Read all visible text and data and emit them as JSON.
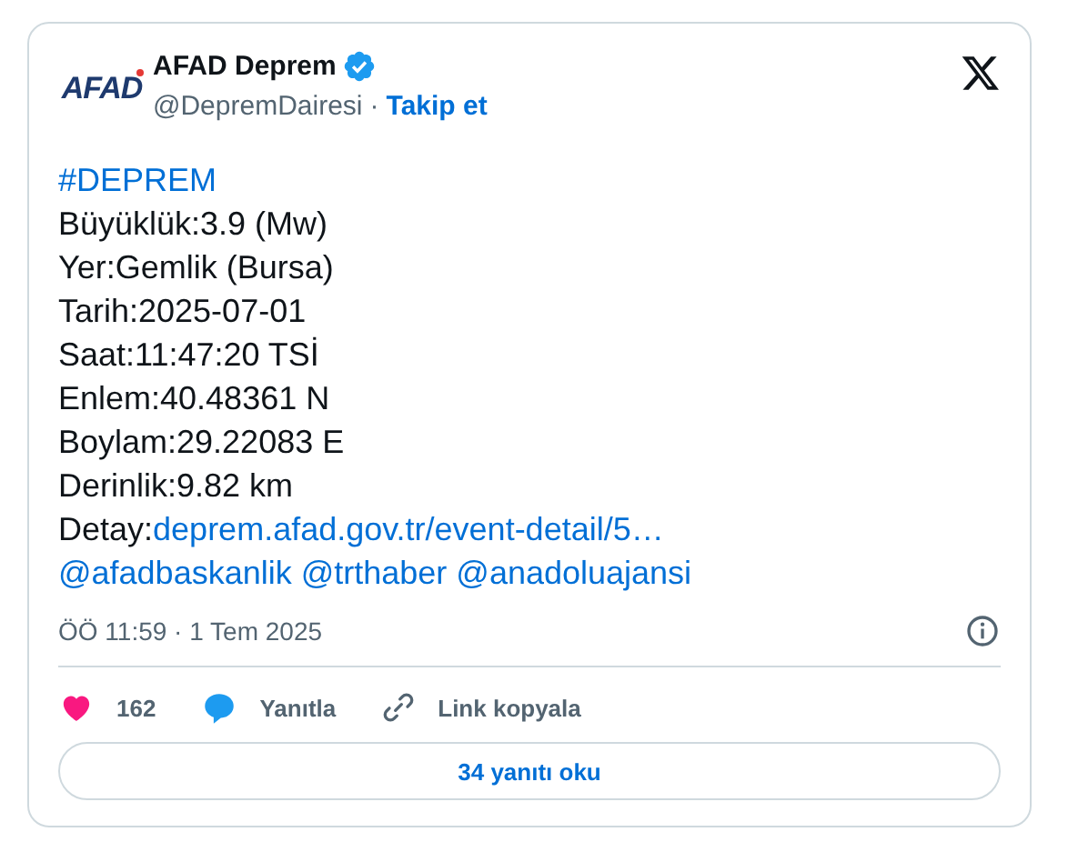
{
  "author": {
    "logo_text": "AFAD",
    "name": "AFAD Deprem",
    "verified": true,
    "handle": "@DepremDairesi",
    "separator": "·",
    "follow": "Takip et"
  },
  "body": [
    {
      "parts": [
        {
          "kind": "link",
          "text": "#DEPREM"
        }
      ]
    },
    {
      "parts": [
        {
          "kind": "plain",
          "text": "Büyüklük:3.9 (Mw)"
        }
      ]
    },
    {
      "parts": [
        {
          "kind": "plain",
          "text": "Yer:Gemlik (Bursa)"
        }
      ]
    },
    {
      "parts": [
        {
          "kind": "plain",
          "text": "Tarih:2025-07-01"
        }
      ]
    },
    {
      "parts": [
        {
          "kind": "plain",
          "text": "Saat:11:47:20 TSİ"
        }
      ]
    },
    {
      "parts": [
        {
          "kind": "plain",
          "text": "Enlem:40.48361 N"
        }
      ]
    },
    {
      "parts": [
        {
          "kind": "plain",
          "text": "Boylam:29.22083 E"
        }
      ]
    },
    {
      "parts": [
        {
          "kind": "plain",
          "text": "Derinlik:9.82 km"
        }
      ]
    },
    {
      "parts": [
        {
          "kind": "plain",
          "text": "Detay:"
        },
        {
          "kind": "link",
          "text": "deprem.afad.gov.tr/event-detail/5…"
        }
      ]
    },
    {
      "parts": [
        {
          "kind": "link",
          "text": "@afadbaskanlik"
        },
        {
          "kind": "link",
          "text": "@trthaber"
        },
        {
          "kind": "link",
          "text": "@anadoluajansi"
        }
      ]
    }
  ],
  "timestamp": "ÖÖ 11:59 · 1 Tem 2025",
  "actions": [
    {
      "kind": "like",
      "label": "162",
      "liked": true
    },
    {
      "kind": "reply",
      "label": "Yanıtla"
    },
    {
      "kind": "copy",
      "label": "Link kopyala"
    }
  ],
  "read_replies": "34 yanıtı oku"
}
